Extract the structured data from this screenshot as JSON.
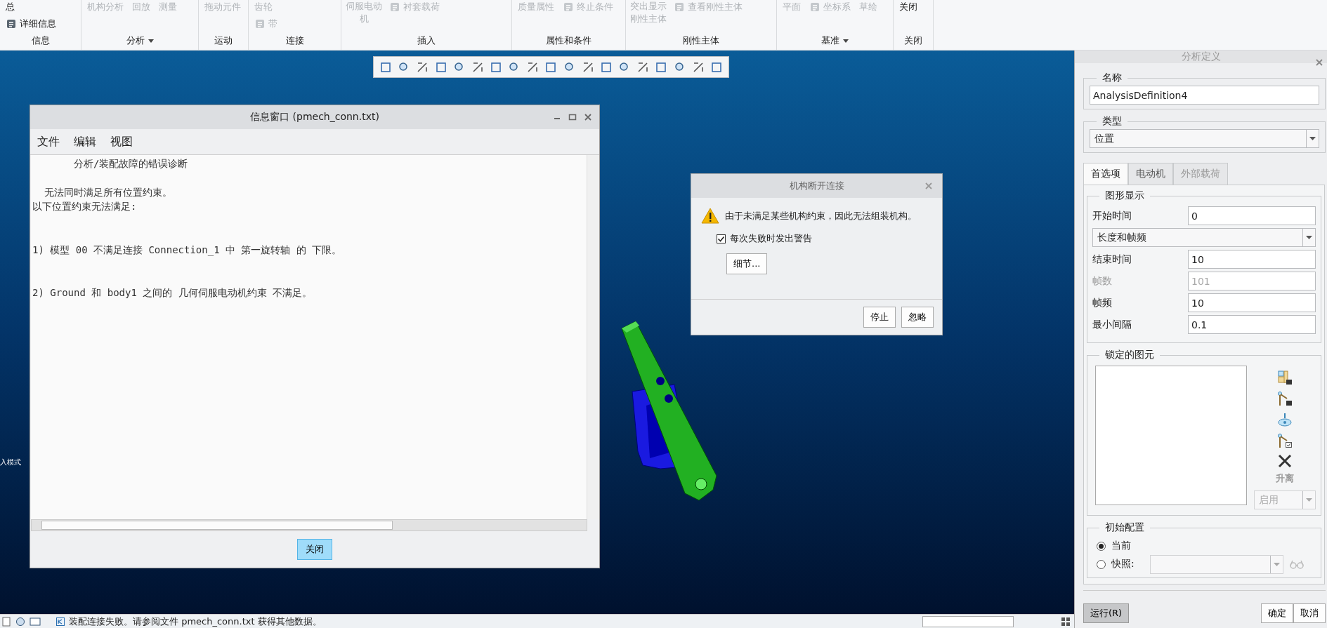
{
  "ribbon": {
    "groups": [
      {
        "label": "信息",
        "dropdown": false,
        "columns": [
          [
            {
              "text": "总",
              "kind": "small",
              "enabled": true,
              "icon": false
            },
            {
              "text": "详细信息",
              "kind": "small",
              "enabled": true,
              "icon": true
            }
          ]
        ]
      },
      {
        "label": "分析",
        "dropdown": true,
        "columns": [
          [
            {
              "text": "机构分析",
              "kind": "small",
              "enabled": false,
              "icon": false
            }
          ],
          [
            {
              "text": "回放",
              "kind": "small",
              "enabled": false,
              "icon": false
            }
          ],
          [
            {
              "text": "测量",
              "kind": "small",
              "enabled": false,
              "icon": false
            }
          ]
        ]
      },
      {
        "label": "运动",
        "dropdown": false,
        "columns": [
          [
            {
              "text": "拖动元件",
              "kind": "small",
              "enabled": false,
              "icon": false
            }
          ]
        ]
      },
      {
        "label": "连接",
        "dropdown": false,
        "columns": [
          [
            {
              "text": "齿轮",
              "kind": "small",
              "enabled": false,
              "icon": false
            },
            {
              "text": "带",
              "kind": "small",
              "enabled": false,
              "icon": true
            }
          ]
        ]
      },
      {
        "label": "插入",
        "dropdown": false,
        "columns": [
          [
            {
              "text": "伺服电动机",
              "kind": "large",
              "enabled": false,
              "icon": false
            }
          ],
          [
            {
              "text": "衬套载荷",
              "kind": "small",
              "enabled": false,
              "icon": true
            }
          ]
        ]
      },
      {
        "label": "属性和条件",
        "dropdown": false,
        "columns": [
          [
            {
              "text": "质量属性",
              "kind": "small",
              "enabled": false,
              "icon": false
            }
          ],
          [
            {
              "text": "终止条件",
              "kind": "small",
              "enabled": false,
              "icon": true
            }
          ]
        ]
      },
      {
        "label": "刚性主体",
        "dropdown": false,
        "columns": [
          [
            {
              "text": "突出显示刚性主体",
              "kind": "large",
              "enabled": false,
              "icon": false
            }
          ],
          [
            {
              "text": "查看刚性主体",
              "kind": "small",
              "enabled": false,
              "icon": true
            }
          ]
        ]
      },
      {
        "label": "基准",
        "dropdown": true,
        "columns": [
          [
            {
              "text": "平面",
              "kind": "small",
              "enabled": false,
              "icon": false
            }
          ],
          [
            {
              "text": "坐标系",
              "kind": "small",
              "enabled": false,
              "icon": true
            }
          ],
          [
            {
              "text": "草绘",
              "kind": "small",
              "enabled": false,
              "icon": false
            }
          ]
        ]
      },
      {
        "label": "关闭",
        "dropdown": false,
        "columns": [
          [
            {
              "text": "关闭",
              "kind": "small",
              "enabled": true,
              "icon": false
            }
          ]
        ]
      }
    ]
  },
  "viewport": {
    "edge_label": "入模式"
  },
  "info_window": {
    "title": "信息窗口 (pmech_conn.txt)",
    "menu": [
      "文件",
      "编辑",
      "视图"
    ],
    "paragraphs": [
      [
        "       分析/装配故障的错误诊断"
      ],
      [
        "  无法同时满足所有位置约束。",
        "以下位置约束无法满足:"
      ],
      [
        "1) 模型 00 不满足连接 Connection_1 中 第一旋转轴 的 下限。"
      ],
      [
        "2) Ground 和 body1 之间的 几何伺服电动机约束 不满足。"
      ]
    ],
    "close_button": "关闭"
  },
  "dialog": {
    "title": "机构断开连接",
    "message": "由于未满足某些机构约束，因此无法组装机构。",
    "checkbox": {
      "label": "每次失败时发出警告",
      "checked": true
    },
    "details_button": "细节...",
    "buttons": [
      "停止",
      "忽略"
    ]
  },
  "panel": {
    "title": "分析定义",
    "name": {
      "label": "名称",
      "value": "AnalysisDefinition4"
    },
    "type": {
      "label": "类型",
      "value": "位置"
    },
    "tabs": [
      {
        "label": "首选项",
        "selected": true,
        "disabled": false
      },
      {
        "label": "电动机",
        "selected": false,
        "disabled": false
      },
      {
        "label": "外部载荷",
        "selected": false,
        "disabled": true
      }
    ],
    "graphics": {
      "label": "图形显示",
      "start_time": {
        "label": "开始时间",
        "value": "0"
      },
      "mode": "长度和帧频",
      "fields": [
        {
          "label": "结束时间",
          "value": "10",
          "disabled": false
        },
        {
          "label": "帧数",
          "value": "101",
          "disabled": true
        },
        {
          "label": "帧频",
          "value": "10",
          "disabled": false
        },
        {
          "label": "最小间隔",
          "value": "0.1",
          "disabled": false
        }
      ]
    },
    "locked": {
      "label": "锁定的图元",
      "lift_label": "升离",
      "lift_disabled": true,
      "mode": {
        "value": "启用",
        "disabled": true
      }
    },
    "initial_config": {
      "label": "初始配置",
      "options": [
        {
          "label": "当前",
          "selected": true
        },
        {
          "label": "快照:",
          "selected": false
        }
      ],
      "snapshot_disabled": true
    },
    "buttons": [
      {
        "label": "运行(R)",
        "pressed": true
      },
      {
        "label": "确定",
        "pressed": false
      },
      {
        "label": "取消",
        "pressed": false
      }
    ]
  },
  "status_bar": {
    "message": "装配连接失败。请参阅文件 pmech_conn.txt 获得其他数据。"
  }
}
